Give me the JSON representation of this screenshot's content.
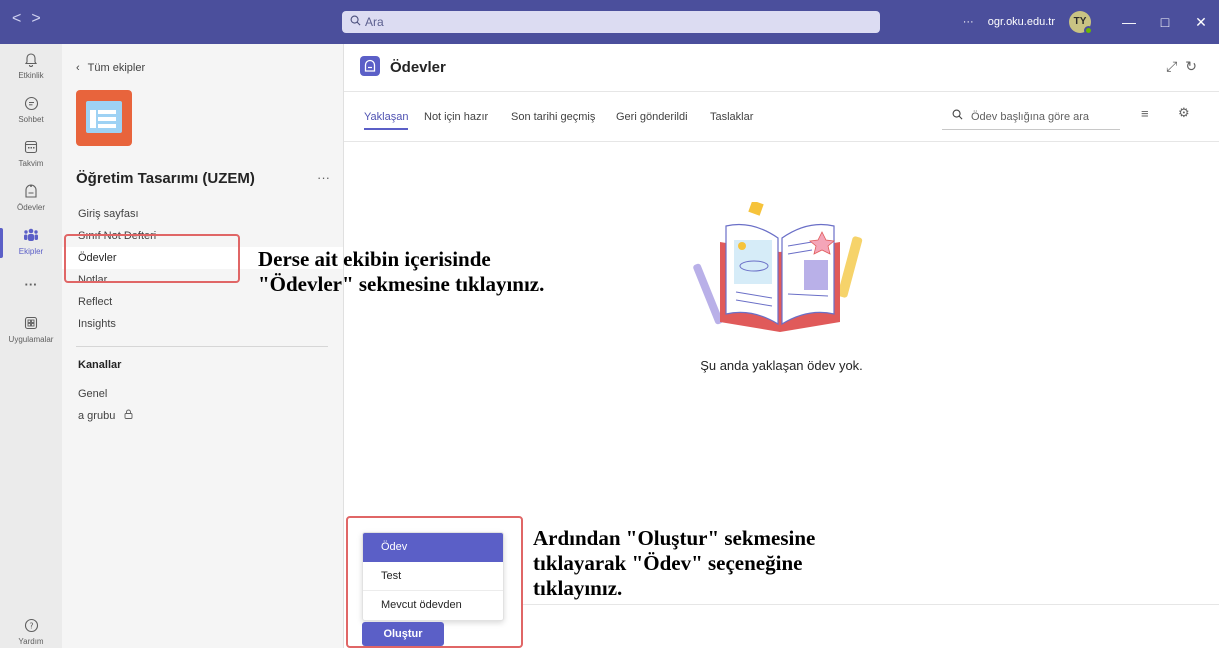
{
  "titlebar": {
    "nav_back": "<",
    "nav_forward": ">",
    "search_placeholder": "Ara",
    "more": "···",
    "account": "ogr.oku.edu.tr",
    "avatar_initials": "TY",
    "minimize": "—",
    "maximize": "□",
    "close": "✕"
  },
  "rail": {
    "items": [
      {
        "icon": "bell-icon",
        "label": "Etkinlik"
      },
      {
        "icon": "chat-icon",
        "label": "Sohbet"
      },
      {
        "icon": "calendar-icon",
        "label": "Takvim"
      },
      {
        "icon": "assignments-icon",
        "label": "Ödevler"
      },
      {
        "icon": "teams-icon",
        "label": "Ekipler"
      },
      {
        "icon": "more-icon",
        "label": "···"
      },
      {
        "icon": "apps-icon",
        "label": "Uygulamalar"
      },
      {
        "icon": "help-icon",
        "label": "Yardım"
      }
    ]
  },
  "sidebar": {
    "back_label": "Tüm ekipler",
    "team_name": "Öğretim Tasarımı (UZEM)",
    "more": "···",
    "nav": [
      "Giriş sayfası",
      "Sınıf Not Defteri",
      "Ödevler",
      "Notlar",
      "Reflect",
      "Insights"
    ],
    "channels_title": "Kanallar",
    "channels": [
      "Genel",
      "a grubu"
    ]
  },
  "main": {
    "app_title": "Ödevler",
    "tabs": [
      "Yaklaşan",
      "Not için hazır",
      "Son tarihi geçmiş",
      "Geri gönderildi",
      "Taslaklar"
    ],
    "search_placeholder": "Ödev başlığına göre ara",
    "empty_text": "Şu anda yaklaşan ödev yok.",
    "menu_items": [
      "Ödev",
      "Test",
      "Mevcut ödevden"
    ],
    "create_label": "Oluştur"
  },
  "annotations": {
    "note1_line1": "Derse ait ekibin içerisinde",
    "note1_line2": "\"Ödevler\" sekmesine tıklayınız.",
    "note2_line1": "Ardından \"Oluştur\" sekmesine",
    "note2_line2": "tıklayarak \"Ödev\" seçeneğine",
    "note2_line3": "tıklayınız."
  },
  "colors": {
    "titlebar": "#4b4f9c",
    "accent": "#5b5fc7",
    "annotation_box": "#e06666"
  }
}
